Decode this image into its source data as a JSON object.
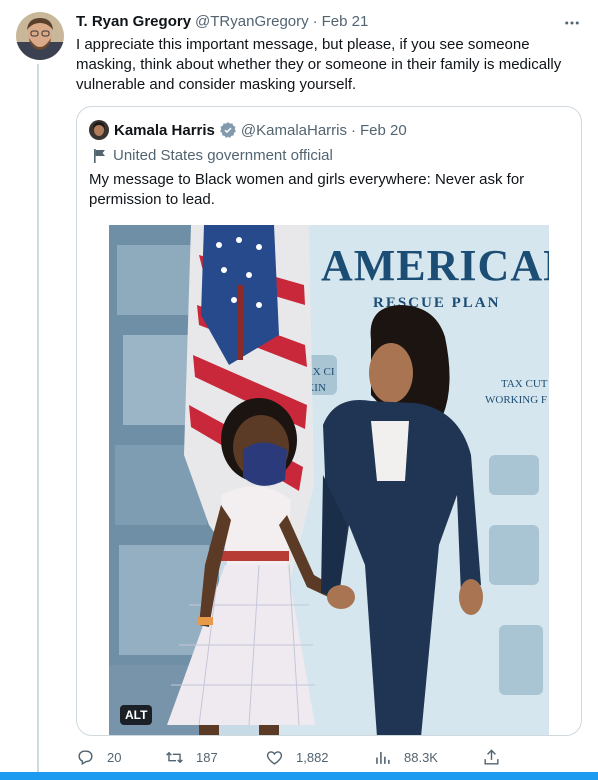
{
  "tweet": {
    "author_name": "T. Ryan Gregory",
    "handle": "@TRyanGregory",
    "separator": "·",
    "date": "Feb 21",
    "text": "I appreciate this important message, but please, if you see someone masking, think about whether they or someone in their family is medically vulnerable and consider masking yourself."
  },
  "quoted": {
    "author_name": "Kamala Harris",
    "handle": "@KamalaHarris",
    "separator": "·",
    "date": "Feb 20",
    "label": "United States government official",
    "text": "My message to Black women and girls everywhere: Never ask for permission to lead.",
    "image": {
      "banner_title": "AMERICAN",
      "banner_subtitle": "RESCUE PLAN",
      "panel_left": [
        "TAX CI",
        "RKIN"
      ],
      "panel_right": [
        "TAX CUT",
        "WORKING F"
      ],
      "alt_badge": "ALT"
    }
  },
  "actions": {
    "replies": "20",
    "retweets": "187",
    "likes": "1,882",
    "views": "88.3K"
  },
  "colors": {
    "accent": "#1d9bf0",
    "muted": "#536471",
    "border": "#cfd9de"
  }
}
